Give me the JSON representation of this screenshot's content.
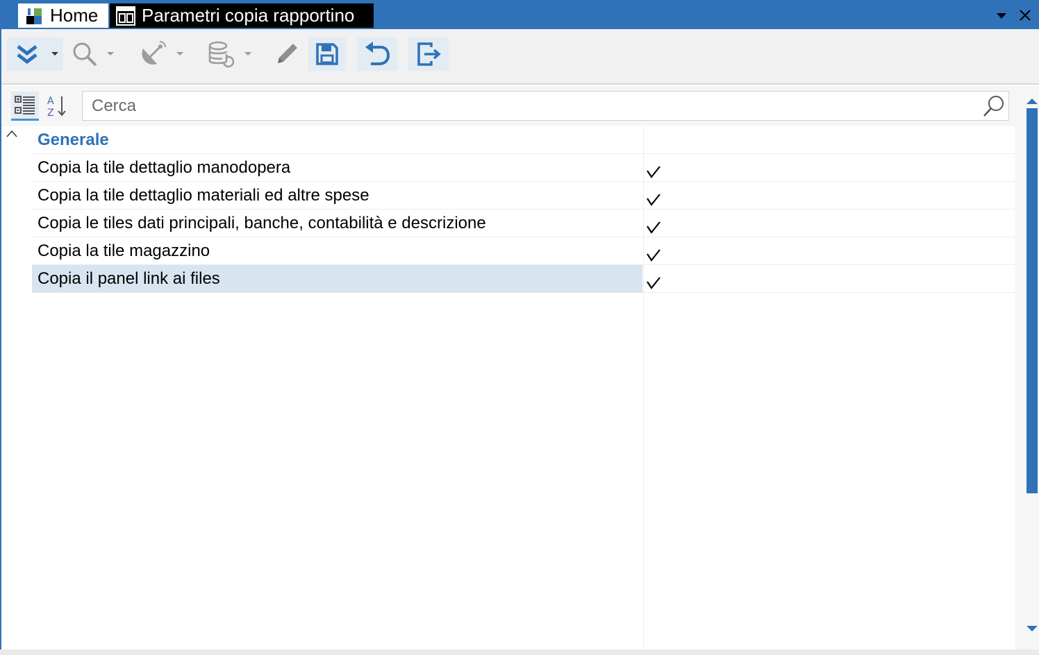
{
  "tabs": [
    {
      "label": "Home",
      "icon": "app-logo-icon",
      "active": false
    },
    {
      "label": "Parametri copia rapportino",
      "icon": "form-window-icon",
      "active": true
    }
  ],
  "title_controls": [
    "dropdown-arrow-icon",
    "close-icon"
  ],
  "toolbar": {
    "buttons": [
      {
        "name": "expand-menu-button",
        "icon": "double-chevron-down-icon",
        "has_dropdown": true,
        "enabled": true
      },
      {
        "name": "search-button",
        "icon": "magnifier-icon",
        "has_dropdown": true,
        "enabled": false
      },
      {
        "name": "satellite-button",
        "icon": "satellite-dish-icon",
        "has_dropdown": true,
        "enabled": false
      },
      {
        "name": "database-button",
        "icon": "database-refresh-icon",
        "has_dropdown": true,
        "enabled": false
      },
      {
        "name": "edit-button",
        "icon": "pencil-icon",
        "has_dropdown": false,
        "enabled": false
      },
      {
        "name": "save-button",
        "icon": "floppy-disk-icon",
        "has_dropdown": false,
        "enabled": true
      },
      {
        "name": "undo-button",
        "icon": "undo-arrow-icon",
        "has_dropdown": false,
        "enabled": true
      },
      {
        "name": "exit-button",
        "icon": "exit-door-icon",
        "has_dropdown": false,
        "enabled": true
      }
    ]
  },
  "property_grid": {
    "view_buttons": [
      {
        "name": "categorized-view-button",
        "icon": "categorized-list-icon",
        "active": true
      },
      {
        "name": "alphabetical-view-button",
        "icon": "sort-az-icon",
        "active": false
      }
    ],
    "search": {
      "placeholder": "Cerca",
      "value": ""
    },
    "category": "Generale",
    "rows": [
      {
        "label": "Copia la tile dettaglio manodopera",
        "checked": true,
        "selected": false
      },
      {
        "label": "Copia la tile dettaglio materiali ed altre spese",
        "checked": true,
        "selected": false
      },
      {
        "label": "Copia le tiles dati principali, banche, contabilità e descrizione",
        "checked": true,
        "selected": false
      },
      {
        "label": "Copia la tile magazzino",
        "checked": true,
        "selected": false
      },
      {
        "label": "Copia il panel link ai files",
        "checked": true,
        "selected": true
      }
    ]
  },
  "colors": {
    "accent": "#2f72b8",
    "selection": "#d8e4ef",
    "toolbar_bg": "#f1f1f1"
  }
}
